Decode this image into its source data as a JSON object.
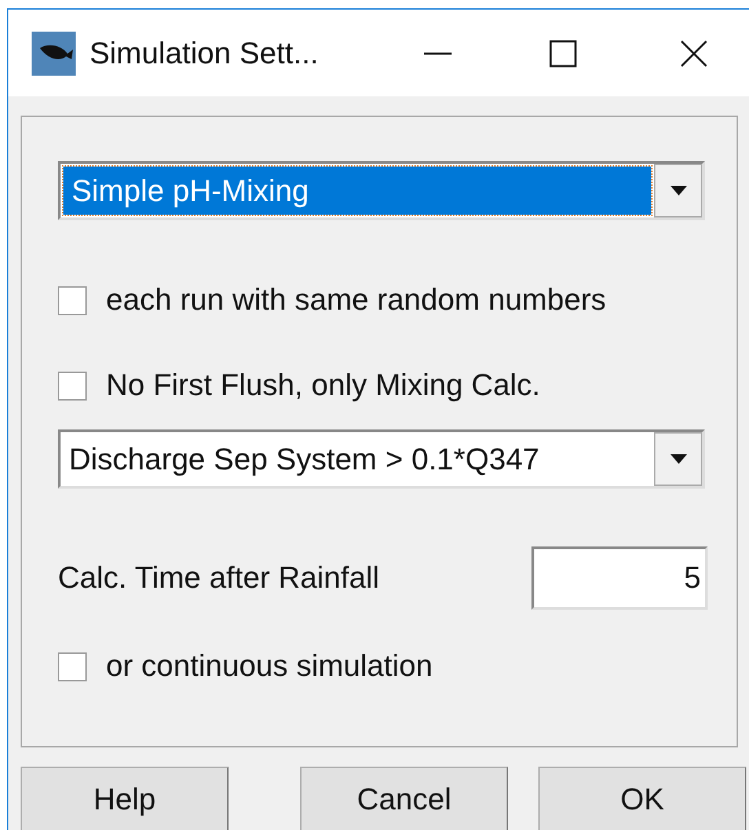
{
  "window": {
    "title": "Simulation Sett..."
  },
  "mode_select": {
    "value": "Simple pH-Mixing",
    "focused": true
  },
  "options": [
    {
      "label": "each run with same random numbers",
      "checked": false
    },
    {
      "label": "No First Flush, only Mixing Calc.",
      "checked": false
    }
  ],
  "discharge_select": {
    "value": "Discharge Sep System > 0.1*Q347"
  },
  "calc_time": {
    "label": "Calc. Time after Rainfall",
    "value": "5"
  },
  "continuous": {
    "label": "or continuous simulation",
    "checked": false
  },
  "buttons": [
    "Help",
    "Cancel",
    "OK"
  ]
}
